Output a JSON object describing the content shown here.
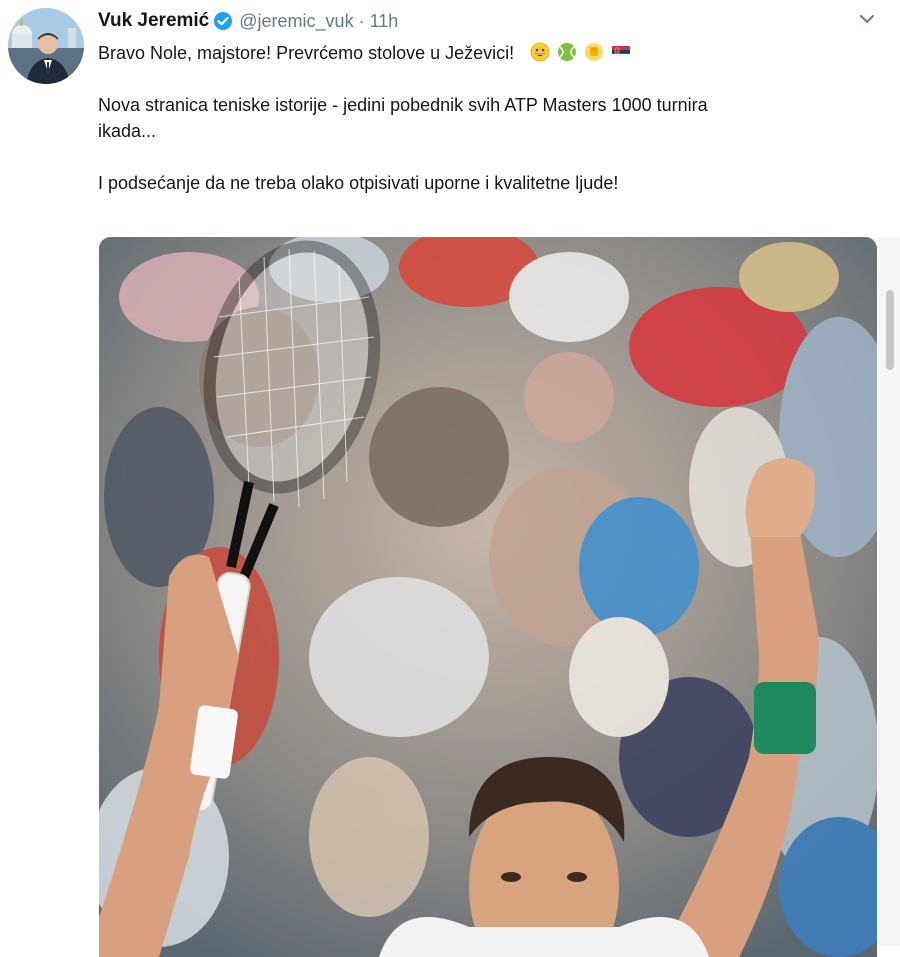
{
  "user": {
    "name": "Vuk Jeremić",
    "handle": "@jeremic_vuk",
    "separator": "·",
    "time": "11h"
  },
  "tweet": {
    "line1": "Bravo Nole, majstore! Prevrćemo stolove u Ježevici!",
    "line2": "Nova stranica teniske istorije - jedini pobednik svih ATP Masters 1000 turnira",
    "line3": "ikada...",
    "line4": "I podsećanje da ne treba olako otpisivati uporne i kvalitetne ljude!"
  },
  "emojis": [
    "grinning-face-icon",
    "tennis-ball-icon",
    "raised-fist-icon",
    "serbia-flag-icon"
  ],
  "colors": {
    "verified": "#1da1f2",
    "secondary_text": "#657786",
    "wristband": "#1f8a5f"
  }
}
